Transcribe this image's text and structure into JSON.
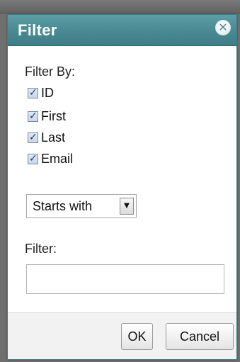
{
  "dialog": {
    "title": "Filter",
    "close_glyph": "✕",
    "filter_by_label": "Filter By:",
    "filter_by_options": [
      {
        "label": "ID",
        "checked": true
      },
      {
        "label": "First",
        "checked": true
      },
      {
        "label": "Last",
        "checked": true
      },
      {
        "label": "Email",
        "checked": true
      }
    ],
    "match_mode": {
      "selected": "Starts with"
    },
    "filter_label": "Filter:",
    "filter_input": {
      "value": "",
      "placeholder": ""
    },
    "buttons": {
      "ok": "OK",
      "cancel": "Cancel"
    }
  },
  "colors": {
    "titlebar": "#4b8c95",
    "title_text": "#ffffff",
    "backdrop": "#6f6f6f"
  },
  "icons": {
    "close": "close-icon",
    "checkbox_check": "checkmark-icon",
    "dropdown_arrow": "chevron-down-icon"
  }
}
